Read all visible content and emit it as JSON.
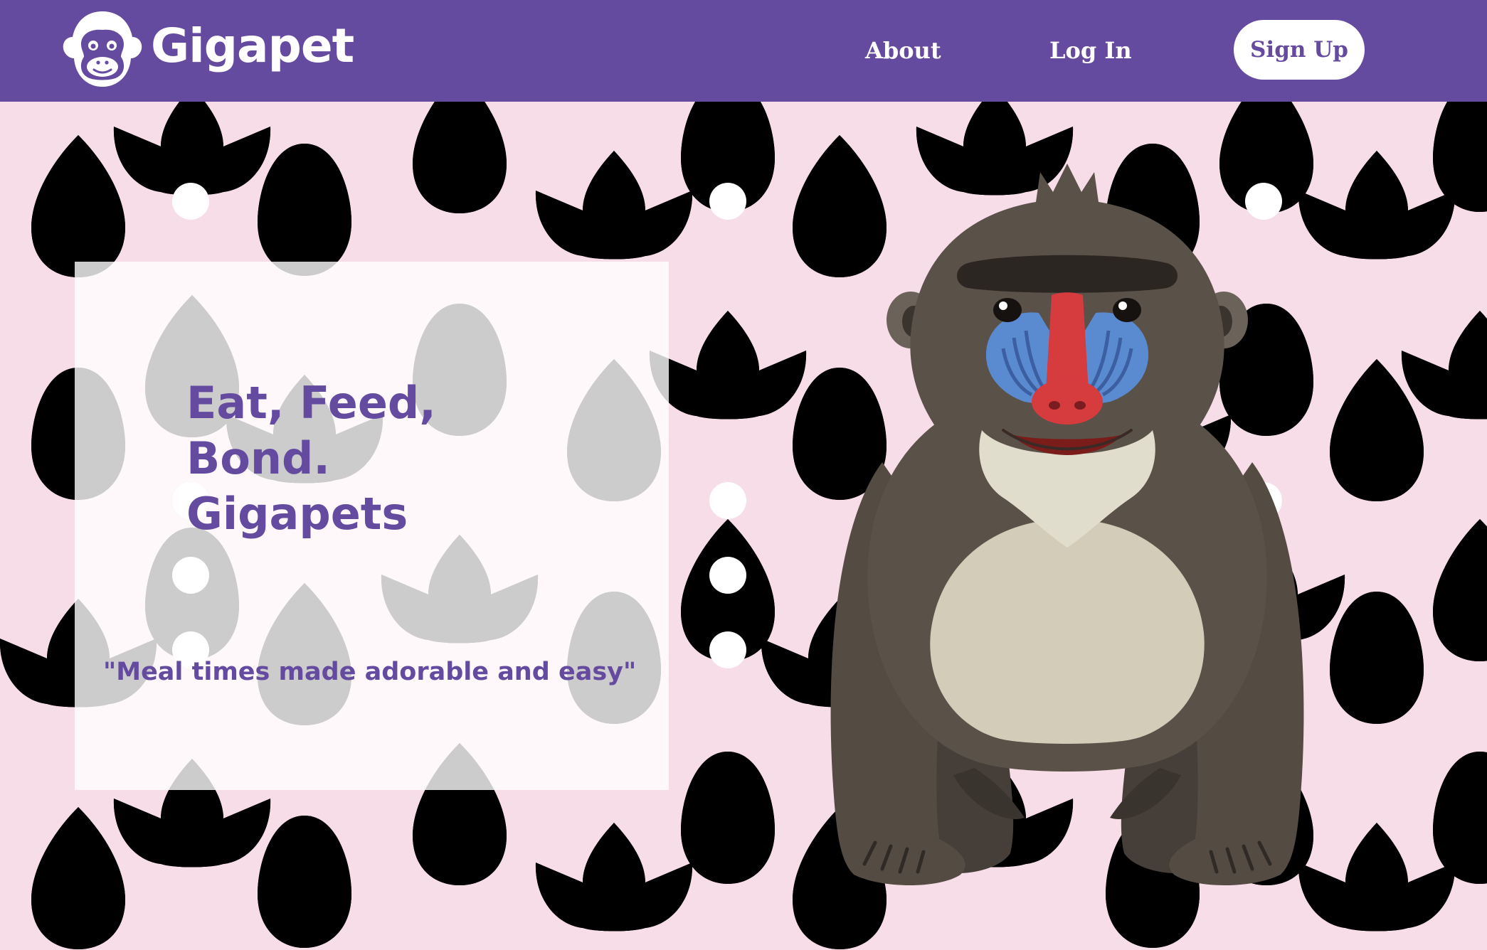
{
  "header": {
    "brand": {
      "name": "Gigapet",
      "logo_icon": "gorilla-face-icon"
    },
    "nav": {
      "about_label": "About",
      "login_label": "Log In",
      "signup_label": "Sign Up"
    }
  },
  "hero": {
    "title_lines": [
      "Eat, Feed,",
      "Bond.",
      "Gigapets"
    ],
    "tagline": "\"Meal times made adorable and easy\""
  },
  "illustration": {
    "mascot_icon": "mandrill-icon",
    "background_icon": "leaf-pattern-icon"
  },
  "colors": {
    "brand_purple": "#654b9f",
    "page_background": "#f7dde8",
    "leaf_magenta": "#9a1f63",
    "leaf_pink": "#e37ca9",
    "leaf_rose": "#a84f52",
    "mascot_fur": "#5a5148"
  }
}
